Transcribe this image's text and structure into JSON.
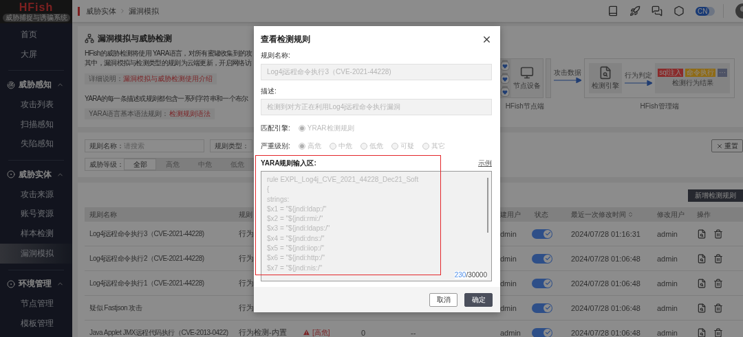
{
  "sidebar": {
    "logo": "HFish",
    "subtitle": "威胁捕捉与诱骗系统",
    "items": [
      {
        "label": "首页",
        "selected": false
      },
      {
        "label": "大屏",
        "selected": false
      }
    ],
    "groups": [
      {
        "label": "威胁感知",
        "expanded": true,
        "children": [
          {
            "label": "攻击列表",
            "selected": false
          },
          {
            "label": "扫描感知",
            "selected": false
          },
          {
            "label": "失陷感知",
            "selected": false
          }
        ]
      },
      {
        "label": "威胁实体",
        "expanded": true,
        "children": [
          {
            "label": "攻击来源",
            "selected": false
          },
          {
            "label": "账号资源",
            "selected": false
          },
          {
            "label": "样本检测",
            "selected": false
          },
          {
            "label": "漏洞模拟",
            "selected": true
          }
        ]
      },
      {
        "label": "环境管理",
        "expanded": true,
        "children": [
          {
            "label": "节点管理",
            "selected": false
          },
          {
            "label": "模板管理",
            "selected": false
          }
        ]
      }
    ]
  },
  "header": {
    "breadcrumb": [
      "威胁实体",
      "漏洞模拟"
    ],
    "language": "CN"
  },
  "intro": {
    "title": "漏洞模拟与威胁检测",
    "lines": [
      "HFish的威胁检测将使用 YARA语言，对所有蜜罐收集到的攻",
      "其中，漏洞模拟与检测类型的规则为云端更新，开启网络访"
    ],
    "detail": {
      "label": "详细说明：",
      "link": "漏洞模拟与威胁检测使用介绍"
    },
    "yara_line": "YARA的每一条描述或规则都包含一系列字符串和一个布尔",
    "syntax": {
      "label": "YARA语言基本语法规则：",
      "link": "检测规则语法"
    },
    "diagram": {
      "node_label": "节点设备",
      "node_caption": "HFish节点端",
      "flow_1": "攻击数据",
      "engine": "检测引擎",
      "flow_2": "行为判定",
      "tags": [
        {
          "label": "sql注入",
          "color": "#8a2b2b"
        },
        {
          "label": "命令执行",
          "color": "#8f6b16"
        },
        {
          "label": "···",
          "color": "#4e5366"
        }
      ],
      "result": "检测行为结果",
      "manager_caption": "HFish管理端"
    }
  },
  "filters": {
    "name": {
      "label": "规则名称：",
      "placeholder": "请搜索"
    },
    "type": {
      "label": "规则类型："
    },
    "level": {
      "label": "威胁等级：",
      "options": [
        {
          "label": "全部",
          "selected": true
        },
        {
          "label": "高危",
          "selected": false
        },
        {
          "label": "中危",
          "selected": false
        },
        {
          "label": "低危",
          "selected": false
        }
      ]
    },
    "reset": "重置"
  },
  "table": {
    "add_button": "新增检测规则",
    "header": {
      "name": "规则名称",
      "type": "规则",
      "creator": "建用户",
      "status": "状态",
      "modified": "最近一次修改时间",
      "modifier": "修改用户",
      "actions": "操作"
    },
    "rows": [
      {
        "name": "Log4j远程命令执行3（CVE-2021-44228)",
        "type": "行为",
        "creator": "dmin",
        "enabled": true,
        "modified": "2024/07/28 01:16:31",
        "modifier": "admin"
      },
      {
        "name": "Log4j远程命令执行2（CVE-2021-44228)",
        "type": "行为",
        "creator": "dmin",
        "enabled": true,
        "modified": "2024/07/28 01:06:48",
        "modifier": "admin"
      },
      {
        "name": "Log4j远程命令执行1（CVE-2021-44228)",
        "type": "行为",
        "creator": "dmin",
        "enabled": true,
        "modified": "2024/07/28 01:06:48",
        "modifier": "admin"
      },
      {
        "name": "疑似 Fastjson 攻击",
        "type": "行为",
        "creator": "dmin",
        "enabled": true,
        "modified": "2024/07/28 01:06:48",
        "modifier": "admin"
      },
      {
        "name": "Java Applet JMX远程代码执行（CVE-2013-0422)",
        "type": "行为检测-内置",
        "level": "[高危]",
        "column_5": "0",
        "column_6": "--",
        "creator": "admin",
        "enabled": true,
        "modified": "2024/07/28 01:06:48",
        "modifier": "admin"
      }
    ]
  },
  "dialog": {
    "title": "查看检测规则",
    "fields": [
      {
        "label": "规则名称:",
        "value": "Log4j远程命令执行3（CVE-2021-44228)",
        "disabled": true
      },
      {
        "label": "描述:",
        "value": "检测到对方正在利用Log4j远程命令执行漏洞",
        "disabled": true
      }
    ],
    "radio_groups": [
      {
        "label": "匹配引擎:",
        "disabled": true,
        "options": [
          {
            "label": "YRAR检测规则",
            "selected": true
          }
        ]
      },
      {
        "label": "严重级别:",
        "disabled": true,
        "options": [
          {
            "label": "高危",
            "selected": true
          },
          {
            "label": "中危",
            "selected": false
          },
          {
            "label": "低危",
            "selected": false
          },
          {
            "label": "可疑",
            "selected": false
          },
          {
            "label": "其它",
            "selected": false
          }
        ]
      }
    ],
    "yara": {
      "label": "YARA规则输入区:",
      "example_link": "示例",
      "lines": [
        "rule EXPL_Log4j_CVE_2021_44228_Dec21_Soft",
        "{",
        "strings:",
        "$x1 = \"${jndi:ldap:/\"",
        "$x2 = \"${jndi:rmi:/\"",
        "$x3 = \"${jndi:ldaps:/\"",
        "$x4 = \"${jndi:dns:/\"",
        "$x5 = \"${jndi:iiop:/\"",
        "$x6 = \"${jndi:http:/\"",
        "$x7 = \"${jndi:nis:/\""
      ],
      "count": "230",
      "limit": "/30000"
    },
    "buttons": [
      {
        "label": "取消",
        "kind": "secondary"
      },
      {
        "label": "确定",
        "kind": "primary"
      }
    ]
  }
}
